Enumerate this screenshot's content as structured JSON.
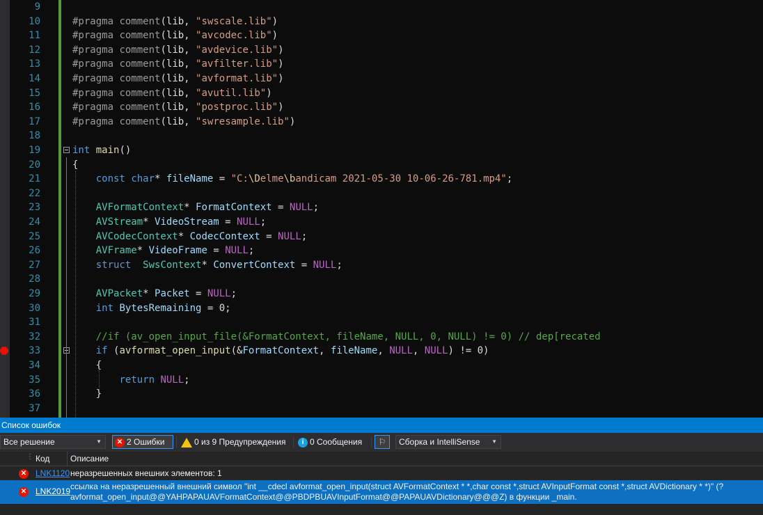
{
  "editor": {
    "lines": [
      {
        "n": "9",
        "html": ""
      },
      {
        "n": "10",
        "html": "<span class='pp'>#pragma</span> <span class='pp'>comment</span>(lib, <span class='str'>\"swscale.lib\"</span>)"
      },
      {
        "n": "11",
        "html": "<span class='pp'>#pragma</span> <span class='pp'>comment</span>(lib, <span class='str'>\"avcodec.lib\"</span>)"
      },
      {
        "n": "12",
        "html": "<span class='pp'>#pragma</span> <span class='pp'>comment</span>(lib, <span class='str'>\"avdevice.lib\"</span>)"
      },
      {
        "n": "13",
        "html": "<span class='pp'>#pragma</span> <span class='pp'>comment</span>(lib, <span class='str'>\"avfilter.lib\"</span>)"
      },
      {
        "n": "14",
        "html": "<span class='pp'>#pragma</span> <span class='pp'>comment</span>(lib, <span class='str'>\"avformat.lib\"</span>)"
      },
      {
        "n": "15",
        "html": "<span class='pp'>#pragma</span> <span class='pp'>comment</span>(lib, <span class='str'>\"avutil.lib\"</span>)"
      },
      {
        "n": "16",
        "html": "<span class='pp'>#pragma</span> <span class='pp'>comment</span>(lib, <span class='str'>\"postproc.lib\"</span>)"
      },
      {
        "n": "17",
        "html": "<span class='pp'>#pragma</span> <span class='pp'>comment</span>(lib, <span class='str'>\"swresample.lib\"</span>)"
      },
      {
        "n": "18",
        "html": ""
      },
      {
        "n": "19",
        "html": "<span class='kw'>int</span> <span class='fn'>main</span>()"
      },
      {
        "n": "20",
        "html": "{"
      },
      {
        "n": "21",
        "html": "    <span class='kw'>const</span> <span class='kw'>char</span>* <span class='var'>fileName</span> = <span class='str'>\"C:</span><span class='esc'>\\D</span><span class='str'>elme</span><span class='esc'>\\b</span><span class='str'>andicam 2021-05-30 10-06-26-781.mp4\"</span>;"
      },
      {
        "n": "22",
        "html": ""
      },
      {
        "n": "23",
        "html": "    <span class='type'>AVFormatContext</span>* <span class='var'>FormatContext</span> = <span class='mac'>NULL</span>;"
      },
      {
        "n": "24",
        "html": "    <span class='type'>AVStream</span>* <span class='var'>VideoStream</span> = <span class='mac'>NULL</span>;"
      },
      {
        "n": "25",
        "html": "    <span class='type'>AVCodecContext</span>* <span class='var'>CodecContext</span> = <span class='mac'>NULL</span>;"
      },
      {
        "n": "26",
        "html": "    <span class='type'>AVFrame</span>* <span class='var'>VideoFrame</span> = <span class='mac'>NULL</span>;"
      },
      {
        "n": "27",
        "html": "    <span class='kw'>struct</span>  <span class='type'>SwsContext</span>* <span class='var'>ConvertContext</span> = <span class='mac'>NULL</span>;"
      },
      {
        "n": "28",
        "html": ""
      },
      {
        "n": "29",
        "html": "    <span class='type'>AVPacket</span>* <span class='var'>Packet</span> = <span class='mac'>NULL</span>;"
      },
      {
        "n": "30",
        "html": "    <span class='kw'>int</span> <span class='var'>BytesRemaining</span> = 0;"
      },
      {
        "n": "31",
        "html": ""
      },
      {
        "n": "32",
        "html": "    <span class='cmt'>//if (av_open_input_file(&amp;FormatContext, fileName, NULL, 0, NULL) != 0) // dep[recated</span>"
      },
      {
        "n": "33",
        "html": "    <span class='kw'>if</span> (<span class='fn'>avformat_open_input</span>(&amp;<span class='var'>FormatContext</span>, <span class='var'>fileName</span>, <span class='mac'>NULL</span>, <span class='mac'>NULL</span>) != 0)"
      },
      {
        "n": "34",
        "html": "    {"
      },
      {
        "n": "35",
        "html": "        <span class='kw'>return</span> <span class='mac'>NULL</span>;"
      },
      {
        "n": "36",
        "html": "    }"
      },
      {
        "n": "37",
        "html": ""
      }
    ]
  },
  "panel": {
    "title": "Список ошибок",
    "scope": "Все решение",
    "errors_label": "2 Ошибки",
    "warnings_label": "0 из 9 Предупреждения",
    "messages_label": "0 Сообщения",
    "build_filter": "Сборка и IntelliSense",
    "col_code": "Код",
    "col_desc": "Описание",
    "rows": [
      {
        "code": "LNK1120",
        "desc": "неразрешенных внешних элементов: 1"
      },
      {
        "code": "LNK2019",
        "desc": "ссылка на неразрешенный внешний символ \"int __cdecl avformat_open_input(struct AVFormatContext * *,char const *,struct AVInputFormat const *,struct AVDictionary * *)\" (?avformat_open_input@@YAHPAPAUAVFormatContext@@PBDPBUAVInputFormat@@PAPAUAVDictionary@@@Z) в функции _main."
      }
    ]
  }
}
